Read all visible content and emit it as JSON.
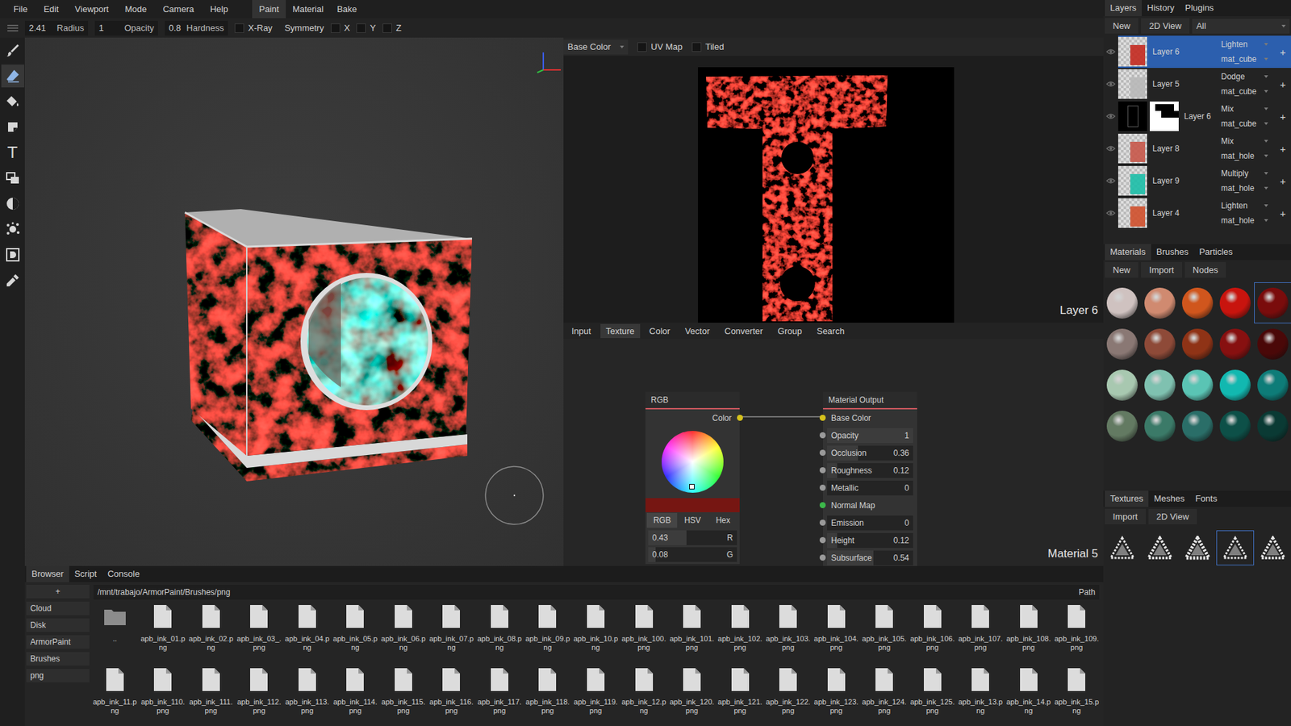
{
  "menu": [
    "File",
    "Edit",
    "Viewport",
    "Mode",
    "Camera",
    "Help"
  ],
  "modes": [
    {
      "label": "Paint",
      "selected": true
    },
    {
      "label": "Material",
      "selected": false
    },
    {
      "label": "Bake",
      "selected": false
    }
  ],
  "toolbar": {
    "sliders": [
      {
        "value": "2.41",
        "label": "Radius"
      },
      {
        "value": "1",
        "label": "Opacity"
      },
      {
        "value": "0.8",
        "label": "Hardness"
      }
    ],
    "xray": {
      "label": "X-Ray",
      "checked": false
    },
    "symmetry": {
      "label": "Symmetry",
      "axes": [
        {
          "label": "X",
          "checked": false
        },
        {
          "label": "Y",
          "checked": false
        },
        {
          "label": "Z",
          "checked": false
        }
      ]
    }
  },
  "tools": [
    {
      "kind": "brush",
      "selected": false
    },
    {
      "kind": "eraser",
      "selected": true
    },
    {
      "kind": "fill",
      "selected": false
    },
    {
      "kind": "decal",
      "selected": false
    },
    {
      "kind": "text",
      "selected": false,
      "glyph": "T"
    },
    {
      "kind": "clone",
      "selected": false
    },
    {
      "kind": "blur",
      "selected": false
    },
    {
      "kind": "particle",
      "selected": false
    },
    {
      "kind": "colorid",
      "selected": false
    },
    {
      "kind": "picker",
      "selected": false
    }
  ],
  "view2d": {
    "channel": "Base Color",
    "uv_map": {
      "label": "UV Map",
      "checked": false
    },
    "tiled": {
      "label": "Tiled",
      "checked": false
    },
    "caption": "Layer 6"
  },
  "node_tabs": [
    {
      "label": "Input",
      "selected": false
    },
    {
      "label": "Texture",
      "selected": true
    },
    {
      "label": "Color",
      "selected": false
    },
    {
      "label": "Vector",
      "selected": false
    },
    {
      "label": "Converter",
      "selected": false
    },
    {
      "label": "Group",
      "selected": false
    },
    {
      "label": "Search",
      "selected": false
    }
  ],
  "nodes": {
    "caption": "Material 5",
    "rgb": {
      "title": "RGB",
      "output": "Color",
      "swatch": "#761612",
      "modes": [
        {
          "label": "RGB",
          "selected": true
        },
        {
          "label": "HSV",
          "selected": false
        },
        {
          "label": "Hex",
          "selected": false
        }
      ],
      "fields": [
        {
          "value": "0.43",
          "label": "R",
          "level": 0.43
        },
        {
          "value": "0.08",
          "label": "G",
          "level": 0.08
        }
      ]
    },
    "output": {
      "title": "Material Output",
      "inputs": [
        {
          "label": "Base Color",
          "kind": "link",
          "color": "#d6c21c"
        },
        {
          "label": "Opacity",
          "kind": "field",
          "value": "1",
          "level": 1,
          "color": "#9a9a9a"
        },
        {
          "label": "Occlusion",
          "kind": "field",
          "value": "0.36",
          "level": 0.36,
          "color": "#9a9a9a"
        },
        {
          "label": "Roughness",
          "kind": "field",
          "value": "0.12",
          "level": 0.12,
          "color": "#9a9a9a"
        },
        {
          "label": "Metallic",
          "kind": "field",
          "value": "0",
          "level": 0,
          "color": "#9a9a9a"
        },
        {
          "label": "Normal Map",
          "kind": "link",
          "color": "#3cb84a"
        },
        {
          "label": "Emission",
          "kind": "field",
          "value": "0",
          "level": 0,
          "color": "#9a9a9a"
        },
        {
          "label": "Height",
          "kind": "field",
          "value": "0.12",
          "level": 0.12,
          "color": "#9a9a9a"
        },
        {
          "label": "Subsurface",
          "kind": "field",
          "value": "0.54",
          "level": 0.54,
          "color": "#9a9a9a"
        }
      ]
    }
  },
  "layers_panel": {
    "tabs": [
      {
        "label": "Layers",
        "selected": true
      },
      {
        "label": "History",
        "selected": false
      },
      {
        "label": "Plugins",
        "selected": false
      }
    ],
    "buttons": [
      "New",
      "2D View"
    ],
    "filter": "All",
    "add": "+",
    "rows": [
      {
        "name": "Layer 6",
        "blend": "Lighten",
        "object": "mat_cube",
        "selected": true,
        "thumbs": [
          {
            "kind": "paint",
            "color": "#c42a20"
          }
        ]
      },
      {
        "name": "Layer 5",
        "blend": "Dodge",
        "object": "mat_cube",
        "selected": false,
        "thumbs": [
          {
            "kind": "paint",
            "color": "#b8b8b8"
          }
        ]
      },
      {
        "name": "Layer 6",
        "blend": "Mix",
        "object": "mat_cube",
        "selected": false,
        "thumbs": [
          {
            "kind": "mask",
            "color": "#000000"
          },
          {
            "kind": "mask",
            "color": "#ffffff"
          }
        ]
      },
      {
        "name": "Layer 8",
        "blend": "Mix",
        "object": "mat_hole",
        "selected": false,
        "thumbs": [
          {
            "kind": "paint",
            "color": "#c8584a"
          }
        ]
      },
      {
        "name": "Layer 9",
        "blend": "Multiply",
        "object": "mat_hole",
        "selected": false,
        "thumbs": [
          {
            "kind": "paint",
            "color": "#1cbfa8"
          }
        ]
      },
      {
        "name": "Layer 4",
        "blend": "Lighten",
        "object": "mat_hole",
        "selected": false,
        "thumbs": [
          {
            "kind": "paint",
            "color": "#d0502c"
          }
        ]
      }
    ]
  },
  "materials_panel": {
    "tabs": [
      {
        "label": "Materials",
        "selected": true
      },
      {
        "label": "Brushes",
        "selected": false
      },
      {
        "label": "Particles",
        "selected": false
      }
    ],
    "buttons": [
      "New",
      "Import",
      "Nodes"
    ],
    "items": [
      {
        "color": "#cfc2c0",
        "selected": false
      },
      {
        "color": "#d08a70",
        "selected": false
      },
      {
        "color": "#d0561d",
        "selected": false
      },
      {
        "color": "#c8140e",
        "selected": false
      },
      {
        "color": "#7a0c0c",
        "selected": true
      },
      {
        "color": "#8a7874",
        "selected": false
      },
      {
        "color": "#8e4a38",
        "selected": false
      },
      {
        "color": "#8f3316",
        "selected": false
      },
      {
        "color": "#871010",
        "selected": false
      },
      {
        "color": "#4a0808",
        "selected": false
      },
      {
        "color": "#a8c8b0",
        "selected": false
      },
      {
        "color": "#7fc1b0",
        "selected": false
      },
      {
        "color": "#5ac4b4",
        "selected": false
      },
      {
        "color": "#12b8b0",
        "selected": false
      },
      {
        "color": "#0e7c78",
        "selected": false
      },
      {
        "color": "#637a62",
        "selected": false
      },
      {
        "color": "#3b7a68",
        "selected": false
      },
      {
        "color": "#2a6e68",
        "selected": false
      },
      {
        "color": "#0d5048",
        "selected": false
      },
      {
        "color": "#0a3a34",
        "selected": false
      }
    ]
  },
  "textures_panel": {
    "tabs": [
      {
        "label": "Textures",
        "selected": true
      },
      {
        "label": "Meshes",
        "selected": false
      },
      {
        "label": "Fonts",
        "selected": false
      }
    ],
    "buttons": [
      "Import",
      "2D View"
    ],
    "items": [
      {
        "selected": false
      },
      {
        "selected": false
      },
      {
        "selected": false
      },
      {
        "selected": true
      },
      {
        "selected": false
      }
    ]
  },
  "browser": {
    "tabs": [
      {
        "label": "Browser",
        "selected": true
      },
      {
        "label": "Script",
        "selected": false
      },
      {
        "label": "Console",
        "selected": false
      }
    ],
    "add": "+",
    "places": [
      "Cloud",
      "Disk",
      "ArmorPaint",
      "Brushes",
      "png"
    ],
    "path": "/mnt/trabajo/ArmorPaint/Brushes/png",
    "path_label": "Path",
    "files": [
      {
        "name": "..",
        "kind": "folder"
      },
      {
        "name": "apb_ink_01.png",
        "kind": "file"
      },
      {
        "name": "apb_ink_02.png",
        "kind": "file"
      },
      {
        "name": "apb_ink_03_.png",
        "kind": "file"
      },
      {
        "name": "apb_ink_04.png",
        "kind": "file"
      },
      {
        "name": "apb_ink_05.png",
        "kind": "file"
      },
      {
        "name": "apb_ink_06.png",
        "kind": "file"
      },
      {
        "name": "apb_ink_07.png",
        "kind": "file"
      },
      {
        "name": "apb_ink_08.png",
        "kind": "file"
      },
      {
        "name": "apb_ink_09.png",
        "kind": "file"
      },
      {
        "name": "apb_ink_10.png",
        "kind": "file"
      },
      {
        "name": "apb_ink_100.png",
        "kind": "file"
      },
      {
        "name": "apb_ink_101.png",
        "kind": "file"
      },
      {
        "name": "apb_ink_102.png",
        "kind": "file"
      },
      {
        "name": "apb_ink_103.png",
        "kind": "file"
      },
      {
        "name": "apb_ink_104.png",
        "kind": "file"
      },
      {
        "name": "apb_ink_105.png",
        "kind": "file"
      },
      {
        "name": "apb_ink_106.png",
        "kind": "file"
      },
      {
        "name": "apb_ink_107.png",
        "kind": "file"
      },
      {
        "name": "apb_ink_108.png",
        "kind": "file"
      },
      {
        "name": "apb_ink_109.png",
        "kind": "file"
      },
      {
        "name": "apb_ink_11.png",
        "kind": "file"
      },
      {
        "name": "apb_ink_110.png",
        "kind": "file"
      },
      {
        "name": "apb_ink_111.png",
        "kind": "file"
      },
      {
        "name": "apb_ink_112.png",
        "kind": "file"
      },
      {
        "name": "apb_ink_113.png",
        "kind": "file"
      },
      {
        "name": "apb_ink_114.png",
        "kind": "file"
      },
      {
        "name": "apb_ink_115.png",
        "kind": "file"
      },
      {
        "name": "apb_ink_116.png",
        "kind": "file"
      },
      {
        "name": "apb_ink_117.png",
        "kind": "file"
      },
      {
        "name": "apb_ink_118.png",
        "kind": "file"
      },
      {
        "name": "apb_ink_119.png",
        "kind": "file"
      },
      {
        "name": "apb_ink_12.png",
        "kind": "file"
      },
      {
        "name": "apb_ink_120.png",
        "kind": "file"
      },
      {
        "name": "apb_ink_121.png",
        "kind": "file"
      },
      {
        "name": "apb_ink_122.png",
        "kind": "file"
      },
      {
        "name": "apb_ink_123.png",
        "kind": "file"
      },
      {
        "name": "apb_ink_124.png",
        "kind": "file"
      },
      {
        "name": "apb_ink_125.png",
        "kind": "file"
      },
      {
        "name": "apb_ink_13.png",
        "kind": "file"
      },
      {
        "name": "apb_ink_14.png",
        "kind": "file"
      },
      {
        "name": "apb_ink_15.png",
        "kind": "file"
      }
    ]
  }
}
